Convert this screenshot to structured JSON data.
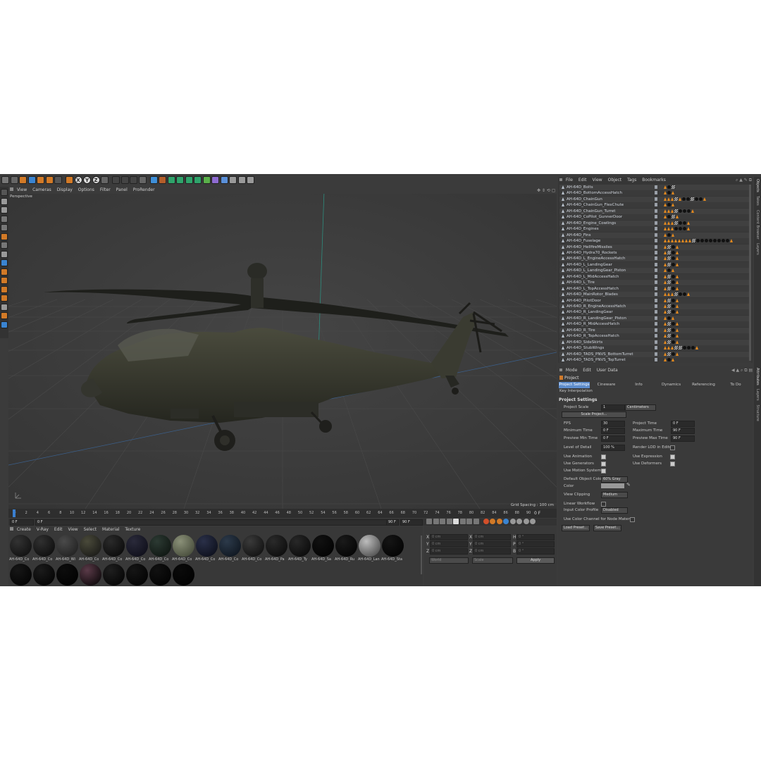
{
  "viewport": {
    "menu": [
      "View",
      "Cameras",
      "Display",
      "Options",
      "Filter",
      "Panel",
      "ProRender"
    ],
    "label": "Perspective",
    "grid_spacing": "Grid Spacing : 100 cm",
    "axis_labels": [
      "X",
      "Y",
      "Z"
    ]
  },
  "timeline": {
    "ticks": [
      "0",
      "2",
      "4",
      "6",
      "8",
      "10",
      "12",
      "14",
      "16",
      "18",
      "20",
      "22",
      "24",
      "26",
      "28",
      "30",
      "32",
      "34",
      "36",
      "38",
      "40",
      "42",
      "44",
      "46",
      "48",
      "50",
      "52",
      "54",
      "56",
      "58",
      "60",
      "62",
      "64",
      "66",
      "68",
      "70",
      "72",
      "74",
      "76",
      "78",
      "80",
      "82",
      "84",
      "86",
      "88",
      "90"
    ],
    "current_frame": "0 F",
    "start": "0 F",
    "start2": "0 F",
    "end": "90 F",
    "end2": "90 F"
  },
  "object_manager": {
    "menu": [
      "File",
      "Edit",
      "View",
      "Object",
      "Tags",
      "Bookmarks"
    ],
    "objects": [
      {
        "name": "AH-64D_Bolts",
        "tags": "tdc"
      },
      {
        "name": "AH-64D_BottomAccessHatch",
        "tags": "tdt"
      },
      {
        "name": "AH-64D_ChainGun",
        "tags": "tttctddcddt"
      },
      {
        "name": "AH-64D_ChainGun_FlexChute",
        "tags": "tdt"
      },
      {
        "name": "AH-64D_ChainGun_Turret",
        "tags": "tttcdddt"
      },
      {
        "name": "AH-64D_CoPilot_GunnerDoor",
        "tags": "tdct"
      },
      {
        "name": "AH-64D_Engine_Cowlings",
        "tags": "tttcddt"
      },
      {
        "name": "AH-64D_Engines",
        "tags": "tttdddt"
      },
      {
        "name": "AH-64D_Fins",
        "tags": "tdt"
      },
      {
        "name": "AH-64D_Fuselage",
        "tags": "ttttttttcddddddddt"
      },
      {
        "name": "AH-64D_HellfireMissiles",
        "tags": "tcdt"
      },
      {
        "name": "AH-64D_Hydra70_Rockets",
        "tags": "tcdt"
      },
      {
        "name": "AH-64D_L_EngineAccessHatch",
        "tags": "tcdt"
      },
      {
        "name": "AH-64D_L_LandingGear",
        "tags": "tcdt"
      },
      {
        "name": "AH-64D_L_LandingGear_Piston",
        "tags": "tdt"
      },
      {
        "name": "AH-64D_L_MidAccessHatch",
        "tags": "tcdt"
      },
      {
        "name": "AH-64D_L_Tire",
        "tags": "tcdt"
      },
      {
        "name": "AH-64D_L_TopAccessHatch",
        "tags": "tcdt"
      },
      {
        "name": "AH-64D_MainRotor_Blades",
        "tags": "tttcddt"
      },
      {
        "name": "AH-64D_PilotDoor",
        "tags": "tcdt"
      },
      {
        "name": "AH-64D_R_EngineAccessHatch",
        "tags": "tcdt"
      },
      {
        "name": "AH-64D_R_LandingGear",
        "tags": "tcdt"
      },
      {
        "name": "AH-64D_R_LandingGear_Piston",
        "tags": "tdt"
      },
      {
        "name": "AH-64D_R_MidAccessHatch",
        "tags": "tcdt"
      },
      {
        "name": "AH-64D_R_Tire",
        "tags": "tcdt"
      },
      {
        "name": "AH-64D_R_TopAccessHatch",
        "tags": "tcdt"
      },
      {
        "name": "AH-64D_SideSkirts",
        "tags": "tcdt"
      },
      {
        "name": "AH-64D_StubWings",
        "tags": "tttccdddt"
      },
      {
        "name": "AH-64D_TADS_PNVS_BottomTurret",
        "tags": "tcdt"
      },
      {
        "name": "AH-64D_TADS_PNVS_TopTurret",
        "tags": "tdt"
      }
    ]
  },
  "attributes": {
    "menu": [
      "Mode",
      "Edit",
      "User Data"
    ],
    "object": "Project",
    "tabs": [
      "Project Settings",
      "Cineware",
      "Info",
      "Dynamics",
      "Referencing",
      "To Do"
    ],
    "tab2": "Key Interpolation",
    "section": "Project Settings",
    "project_scale_label": "Project Scale",
    "project_scale_value": "1",
    "project_scale_unit": "Centimeters",
    "scale_button": "Scale Project...",
    "fps_label": "FPS",
    "fps_value": "30",
    "project_time_label": "Project Time",
    "project_time_value": "0 F",
    "min_time_label": "Minimum Time",
    "min_time_value": "0 F",
    "max_time_label": "Maximum Time",
    "max_time_value": "90 F",
    "prev_min_label": "Preview Min Time",
    "prev_min_value": "0 F",
    "prev_max_label": "Preview Max Time",
    "prev_max_value": "90 F",
    "lod_label": "Level of Detail",
    "lod_value": "100 %",
    "render_lod_label": "Render LOD in Editor",
    "use_animation": "Use Animation",
    "use_expression": "Use Expression",
    "use_generators": "Use Generators",
    "use_deformers": "Use Deformers",
    "use_motion": "Use Motion System",
    "default_color_label": "Default Object Color",
    "default_color_value": "60% Gray",
    "color_label": "Color",
    "view_clipping_label": "View Clipping",
    "view_clipping_value": "Medium",
    "linear_workflow": "Linear Workflow",
    "input_color_label": "Input Color Profile",
    "input_color_value": "Disabled",
    "node_material": "Use Color Channel for Node Material",
    "load_preset": "Load Preset...",
    "save_preset": "Save Preset..."
  },
  "right_strip": [
    "Objects",
    "Takes",
    "Content Browser",
    "Layers"
  ],
  "right_strip2": [
    "Attributes",
    "Layers",
    "Structure"
  ],
  "material_manager": {
    "menu": [
      "Create",
      "V-Ray",
      "Edit",
      "View",
      "Select",
      "Material",
      "Texture"
    ],
    "labels": [
      "AH-64D_Co",
      "AH-64D_Co",
      "AH-64D_Wi",
      "AH-64D_Co",
      "AH-64D_Co",
      "AH-64D_Co",
      "AH-64D_Co",
      "AH-64D_Co",
      "AH-64D_Co",
      "AH-64D_Co",
      "AH-64D_Co",
      "AH-64D_Pa",
      "AH-64D_Ty",
      "AH-64D_Sa",
      "AH-64D_Ru",
      "AH-64D_Lan",
      "AH-64D_Sta"
    ]
  },
  "coordinates": {
    "rows": [
      {
        "axis": "X",
        "pos": "0 cm",
        "axis2": "X",
        "size": "0 cm",
        "axis3": "H",
        "rot": "0 °"
      },
      {
        "axis": "Y",
        "pos": "0 cm",
        "axis2": "Y",
        "size": "0 cm",
        "axis3": "P",
        "rot": "0 °"
      },
      {
        "axis": "Z",
        "pos": "0 cm",
        "axis2": "Z",
        "size": "0 cm",
        "axis3": "B",
        "rot": "0 °"
      }
    ],
    "mode1": "World",
    "mode2": "Scale",
    "apply": "Apply"
  }
}
